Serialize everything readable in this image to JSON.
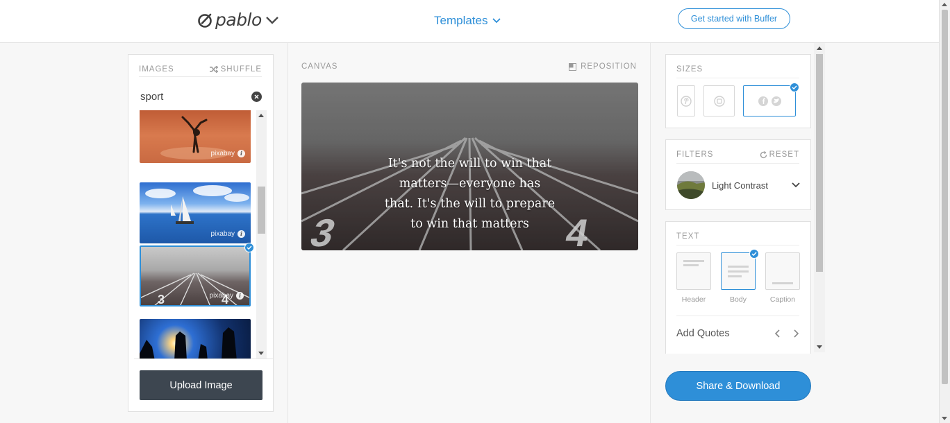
{
  "header": {
    "logo": "pablo",
    "templates_label": "Templates",
    "cta_label": "Get started with Buffer"
  },
  "images_panel": {
    "title": "IMAGES",
    "shuffle_label": "SHUFFLE",
    "search_value": "sport",
    "watermark": "pixabay",
    "selected_index": 2,
    "upload_label": "Upload Image"
  },
  "canvas_panel": {
    "title": "CANVAS",
    "reposition_label": "REPOSITION",
    "quote_lines": [
      "It's not the will to win that",
      "matters—everyone has",
      "that. It's the will to prepare",
      "to win that matters"
    ]
  },
  "sizes_panel": {
    "title": "SIZES",
    "options": [
      "pinterest-icon",
      "instagram-icon",
      "facebook-twitter-icons"
    ],
    "selected": "facebook-twitter-icons"
  },
  "filters_panel": {
    "title": "FILTERS",
    "reset_label": "RESET",
    "selected_filter": "Light Contrast"
  },
  "text_panel": {
    "title": "TEXT",
    "styles": [
      "Header",
      "Body",
      "Caption"
    ],
    "selected": "Body",
    "quotes_label": "Add Quotes"
  },
  "share_label": "Share & Download",
  "colors": {
    "accent": "#2e8fd8",
    "upload_button": "#3d4650"
  }
}
